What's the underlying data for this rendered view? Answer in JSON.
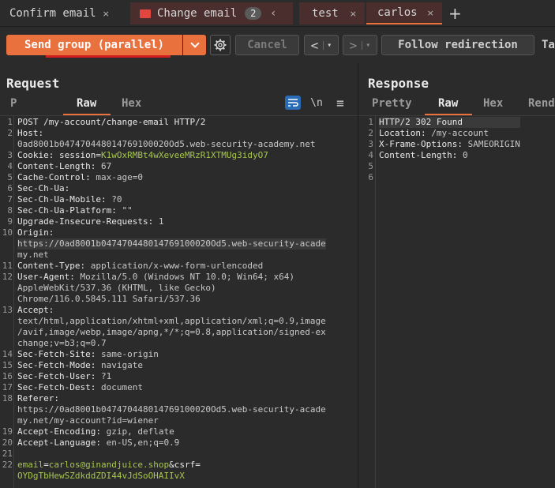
{
  "tabs": [
    {
      "label": "Confirm email",
      "close": "×"
    },
    {
      "label": "Change email",
      "count": "2",
      "chevron": "‹"
    },
    {
      "label": "test",
      "close": "×"
    },
    {
      "label": "carlos",
      "close": "×"
    }
  ],
  "add_tab": "+",
  "toolbar": {
    "send_label": "Send group (parallel)",
    "dropdown": "⌄",
    "settings_icon": "gear-icon",
    "cancel_label": "Cancel",
    "back": "<",
    "forward": ">",
    "nav_dd": "▾",
    "follow_label": "Follow redirection",
    "target_label": "Ta"
  },
  "request": {
    "title": "Request",
    "tabs": [
      "P",
      "Raw",
      "Hex"
    ],
    "active_tab": "Raw",
    "newline_icon": "\\n",
    "menu_icon": "≡",
    "line_numbers": "1\n2\n \n3\n4\n5\n6\n7\n8\n9\n10\n \n \n11\n12\n \n \n13\n \n \n \n14\n15\n16\n17\n18\n \n \n19\n20\n21\n22\n ",
    "lines": [
      {
        "k": "POST /my-account/change-email HTTP/2"
      },
      {
        "k": "Host:"
      },
      {
        "v": "0ad8001b047470448014769100020Od5.web-security-academy.net"
      },
      {
        "k": "Cookie: session=",
        "g": "K1wOxRMBt4wXeveeMRzR1XTMUg3idyO7"
      },
      {
        "k": "Content-Length: ",
        "v": "67"
      },
      {
        "k": "Cache-Control: ",
        "v": "max-age=0"
      },
      {
        "k": "Sec-Ch-Ua:"
      },
      {
        "k": "Sec-Ch-Ua-Mobile: ",
        "v": "?0"
      },
      {
        "k": "Sec-Ch-Ua-Platform: ",
        "v": "\"\""
      },
      {
        "k": "Upgrade-Insecure-Requests: ",
        "v": "1"
      },
      {
        "k": "Origin:"
      },
      {
        "v": "https://0ad8001b047470448014769100020Od5.web-security-acade",
        "hl": true
      },
      {
        "v": "my.net"
      },
      {
        "k": "Content-Type: ",
        "v": "application/x-www-form-urlencoded"
      },
      {
        "k": "User-Agent: ",
        "v": "Mozilla/5.0 (Windows NT 10.0; Win64; x64)"
      },
      {
        "v": "AppleWebKit/537.36 (KHTML, like Gecko)"
      },
      {
        "v": "Chrome/116.0.5845.111 Safari/537.36"
      },
      {
        "k": "Accept:"
      },
      {
        "v": "text/html,application/xhtml+xml,application/xml;q=0.9,image"
      },
      {
        "v": "/avif,image/webp,image/apng,*/*;q=0.8,application/signed-ex"
      },
      {
        "v": "change;v=b3;q=0.7"
      },
      {
        "k": "Sec-Fetch-Site: ",
        "v": "same-origin"
      },
      {
        "k": "Sec-Fetch-Mode: ",
        "v": "navigate"
      },
      {
        "k": "Sec-Fetch-User: ",
        "v": "?1"
      },
      {
        "k": "Sec-Fetch-Dest: ",
        "v": "document"
      },
      {
        "k": "Referer:"
      },
      {
        "v": "https://0ad8001b047470448014769100020Od5.web-security-acade"
      },
      {
        "v": "my.net/my-account?id=wiener"
      },
      {
        "k": "Accept-Encoding: ",
        "v": "gzip, deflate"
      },
      {
        "k": "Accept-Language: ",
        "v": "en-US,en;q=0.9"
      },
      {
        "v": ""
      },
      {
        "g": "email",
        "k": "=",
        "g2": "carlos@ginandjuice.shop",
        "k2": "&csrf="
      },
      {
        "g": "OYDgTbHewSZdkddZDI44vJdSoOHAIIvX"
      }
    ]
  },
  "response": {
    "title": "Response",
    "tabs": [
      "Pretty",
      "Raw",
      "Hex",
      "Rend"
    ],
    "active_tab": "Raw",
    "line_numbers": "1\n2\n3\n4\n5\n6",
    "lines": [
      {
        "k": "HTTP/2 302 Found",
        "hl": true
      },
      {
        "k": "Location: ",
        "v": "/my-account"
      },
      {
        "k": "X-Frame-Options: ",
        "v": "SAMEORIGIN"
      },
      {
        "k": "Content-Length: ",
        "v": "0"
      },
      {
        "v": ""
      },
      {
        "v": ""
      }
    ]
  },
  "colors": {
    "accent": "#e8713d",
    "value_green": "#a7c64c",
    "group_red": "#e2473f"
  }
}
